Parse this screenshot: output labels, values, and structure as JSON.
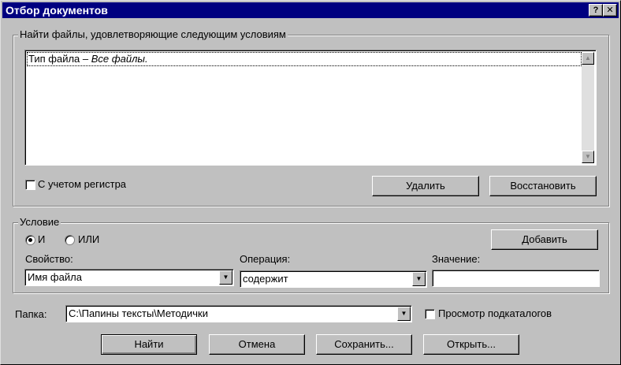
{
  "window": {
    "title": "Отбор документов",
    "help_label": "?",
    "close_label": "✕"
  },
  "criteria_group": {
    "label": "Найти файлы, удовлетворяющие следующим условиям",
    "list_items": [
      {
        "prefix": "Тип файла – ",
        "value": "Все файлы."
      }
    ],
    "case_label": "С учетом регистра",
    "case_checked": false,
    "delete_label": "Удалить",
    "restore_label": "Восстановить"
  },
  "condition_group": {
    "label": "Условие",
    "radio_and_label": "И",
    "radio_or_label": "ИЛИ",
    "selected": "and",
    "add_label": "Добавить",
    "property_label": "Свойство:",
    "property_value": "Имя файла",
    "operation_label": "Операция:",
    "operation_value": "содержит",
    "value_label": "Значение:",
    "value_value": ""
  },
  "folder": {
    "label": "Папка:",
    "value": "C:\\Папины тексты\\Методички",
    "subfolders_label": "Просмотр подкаталогов",
    "subfolders_checked": false
  },
  "buttons": {
    "find_label": "Найти",
    "cancel_label": "Отмена",
    "save_label": "Сохранить...",
    "open_label": "Открыть..."
  }
}
